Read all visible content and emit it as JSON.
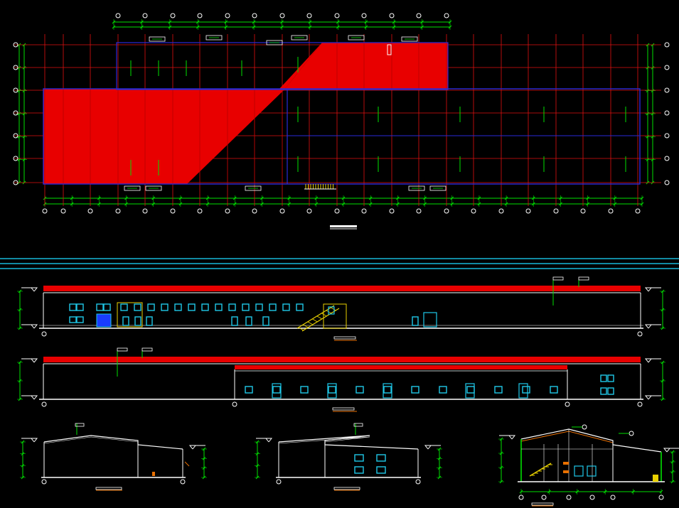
{
  "colors": {
    "background": "#000000",
    "axis_grid": "#e01010",
    "fill": "#e80000",
    "outline_blue": "#2a2ad8",
    "line_white": "#ffffff",
    "dimension_green": "#00e000",
    "separator_cyan": "#17b8d8",
    "window_cyan": "#1fc8e8",
    "highlight_yellow": "#e8d000",
    "door_blue": "#1a3cff",
    "accent_orange": "#e87000"
  },
  "drawings": [
    {
      "kind": "floor-plan",
      "grid_columns": 23,
      "grid_rows": 7
    },
    {
      "kind": "elevation",
      "variant": "front"
    },
    {
      "kind": "elevation",
      "variant": "rear"
    },
    {
      "kind": "section",
      "variant": "side-left"
    },
    {
      "kind": "section",
      "variant": "side-middle"
    },
    {
      "kind": "section",
      "variant": "cross-section"
    }
  ]
}
